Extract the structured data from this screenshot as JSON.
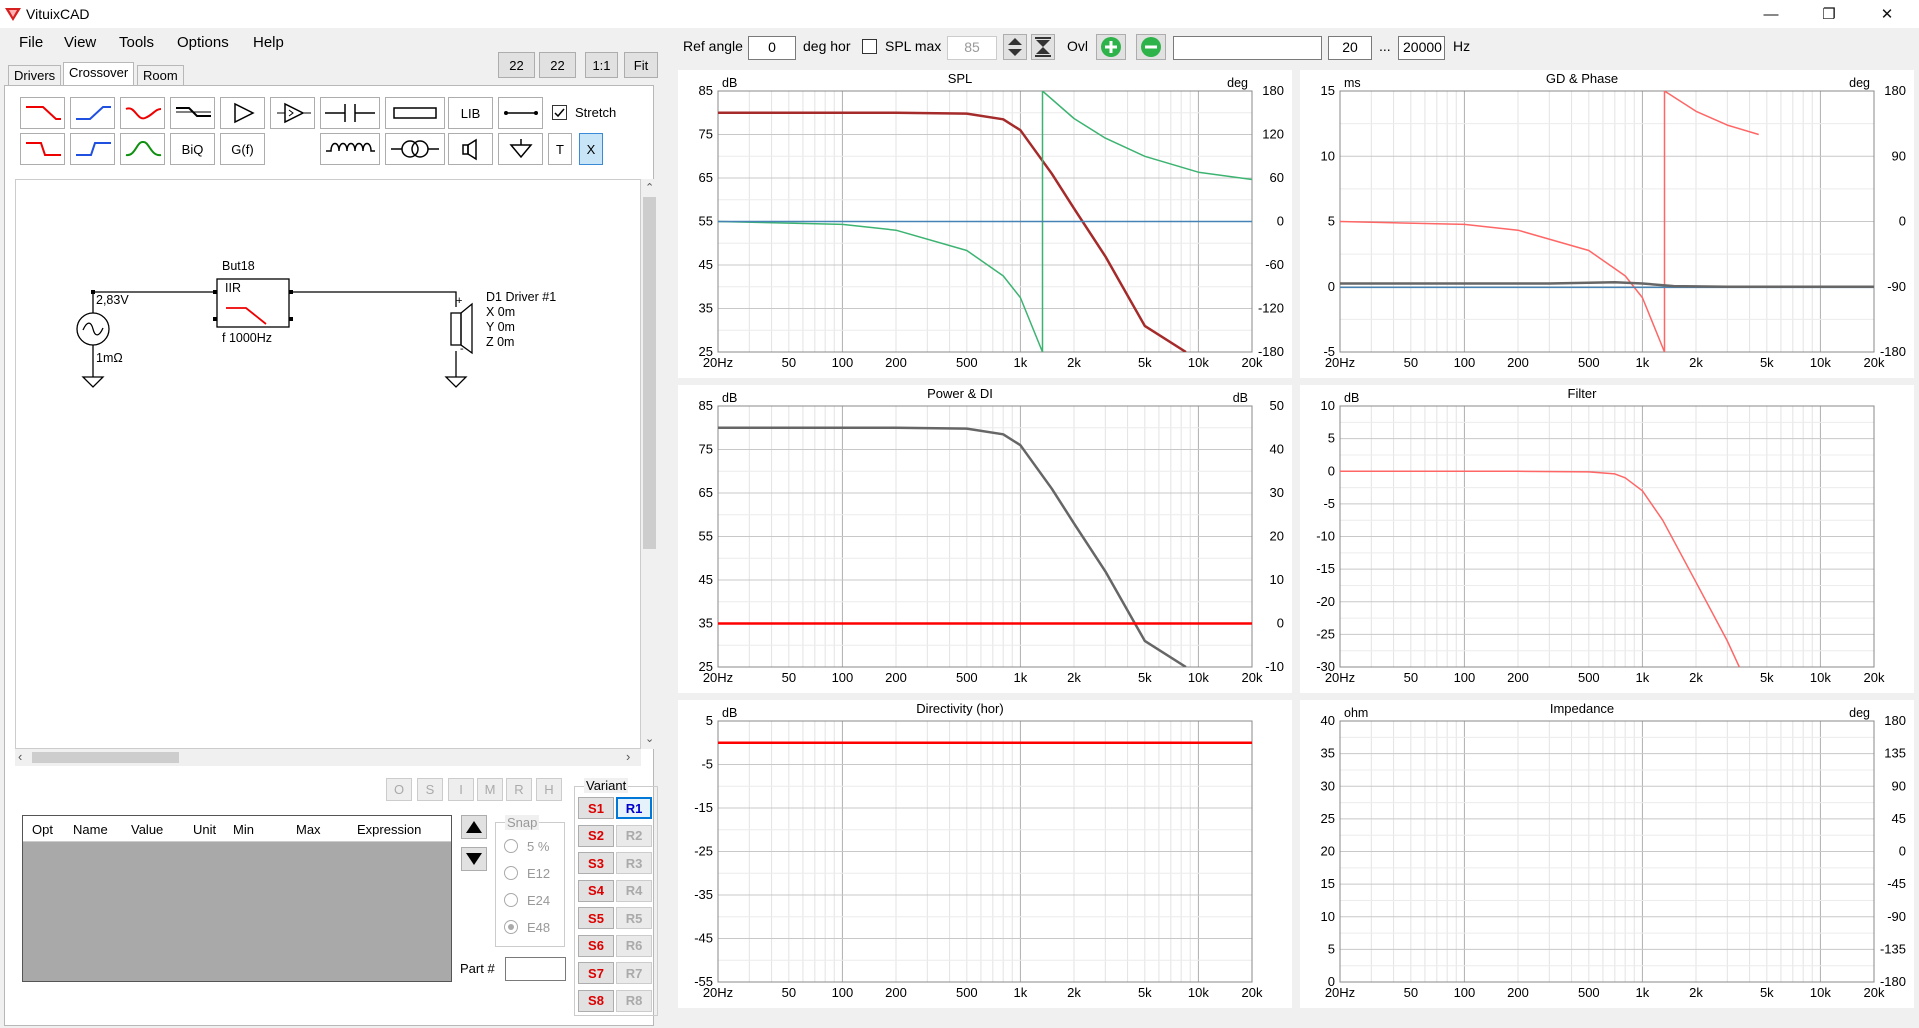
{
  "window": {
    "title": "VituixCAD"
  },
  "menu": [
    "File",
    "View",
    "Tools",
    "Options",
    "Help"
  ],
  "tabs": {
    "drivers": "Drivers",
    "crossover": "Crossover",
    "room": "Room"
  },
  "zoom": {
    "a": "22",
    "b": "22",
    "one": "1:1",
    "fit": "Fit"
  },
  "tools": {
    "lib": "LIB",
    "biq": "BiQ",
    "gf": "G(f)",
    "t": "T",
    "x": "X",
    "stretch": "Stretch"
  },
  "schematic": {
    "voltage": "2,83V",
    "resistance": "1mΩ",
    "block_name": "But18",
    "block_type": "IIR",
    "block_freq": "f   1000Hz",
    "driver_name": "D1 Driver #1",
    "driver_x": "X 0m",
    "driver_y": "Y 0m",
    "driver_z": "Z 0m",
    "plus": "+",
    "minus": "-"
  },
  "part_buttons": [
    "O",
    "S",
    "I",
    "M",
    "R",
    "H"
  ],
  "table": {
    "columns": [
      "Opt",
      "Name",
      "Value",
      "Unit",
      "Min",
      "Max",
      "Expression"
    ]
  },
  "snap": {
    "label": "Snap",
    "options": [
      "5 %",
      "E12",
      "E24",
      "E48"
    ],
    "selected": "E48"
  },
  "part_label": "Part #",
  "variant": {
    "label": "Variant",
    "s": [
      "S1",
      "S2",
      "S3",
      "S4",
      "S5",
      "S6",
      "S7",
      "S8"
    ],
    "r": [
      "R1",
      "R2",
      "R3",
      "R4",
      "R5",
      "R6",
      "R7",
      "R8"
    ],
    "active": "R1"
  },
  "toolbar": {
    "ref_angle_label": "Ref angle",
    "ref_angle_value": "0",
    "deg_hor": "deg hor",
    "spl_max_label": "SPL max",
    "spl_max_value": "85",
    "ovl": "Ovl",
    "freq_min": "20",
    "ellipsis": "...",
    "freq_max": "20000",
    "hz": "Hz"
  },
  "colors": {
    "red": "#ff0000",
    "darkred": "#a52a2a",
    "green": "#3cb371",
    "blue": "#4682b4",
    "gray": "#666666",
    "pink": "#ff6666",
    "accent": "#0078d7"
  },
  "chart_data": [
    {
      "type": "line",
      "title": "SPL",
      "ylabel": "dB",
      "y2label": "deg",
      "xlim": [
        20,
        20000
      ],
      "xscale": "log",
      "x_ticks": [
        "20Hz",
        "50",
        "100",
        "200",
        "500",
        "1k",
        "2k",
        "5k",
        "10k",
        "20k"
      ],
      "ylim": [
        25,
        85
      ],
      "y_ticks": [
        "85",
        "75",
        "65",
        "55",
        "45",
        "35",
        "25"
      ],
      "y2lim": [
        -180,
        180
      ],
      "y2_ticks": [
        "180",
        "120",
        "60",
        "0",
        "-60",
        "-120",
        "-180"
      ],
      "series": [
        {
          "color": "#a52a2a",
          "axis": "y",
          "x": [
            20,
            200,
            500,
            800,
            1000,
            1500,
            2000,
            3000,
            5000,
            8500
          ],
          "y": [
            80,
            80,
            79.8,
            78.5,
            76,
            66,
            58,
            47,
            31,
            25
          ]
        },
        {
          "color": "#3cb371",
          "axis": "y2",
          "x": [
            20,
            100,
            200,
            500,
            800,
            1000,
            1330,
            1331,
            2000,
            3000,
            5000,
            10000,
            20000
          ],
          "y": [
            0,
            -4,
            -12,
            -40,
            -75,
            -105,
            -180,
            180,
            142,
            115,
            90,
            68,
            58
          ]
        },
        {
          "color": "#4682b4",
          "axis": "y2",
          "x": [
            20,
            20000
          ],
          "y": [
            0,
            0
          ]
        }
      ]
    },
    {
      "type": "line",
      "title": "GD & Phase",
      "ylabel": "ms",
      "y2label": "deg",
      "xlim": [
        20,
        20000
      ],
      "xscale": "log",
      "x_ticks": [
        "20Hz",
        "50",
        "100",
        "200",
        "500",
        "1k",
        "2k",
        "5k",
        "10k",
        "20k"
      ],
      "ylim": [
        -5,
        15
      ],
      "y_ticks": [
        "15",
        "10",
        "5",
        "0",
        "-5"
      ],
      "y2lim": [
        -180,
        180
      ],
      "y2_ticks": [
        "180",
        "90",
        "0",
        "-90",
        "-180"
      ],
      "series": [
        {
          "color": "#ff6666",
          "axis": "y2",
          "x": [
            20,
            100,
            200,
            500,
            800,
            1000,
            1330,
            1331,
            2000,
            3000,
            4500
          ],
          "y": [
            0,
            -4,
            -12,
            -40,
            -75,
            -105,
            -180,
            180,
            152,
            133,
            120
          ]
        },
        {
          "color": "#4682b4",
          "axis": "y",
          "x": [
            20,
            20000
          ],
          "y": [
            -0.05,
            -0.05
          ]
        },
        {
          "color": "#666666",
          "axis": "y",
          "x": [
            20,
            300,
            700,
            1000,
            1500,
            3000,
            20000
          ],
          "y": [
            0.25,
            0.25,
            0.35,
            0.25,
            0.05,
            0,
            0
          ]
        }
      ]
    },
    {
      "type": "line",
      "title": "Power & DI",
      "ylabel": "dB",
      "y2label": "dB",
      "xlim": [
        20,
        20000
      ],
      "xscale": "log",
      "x_ticks": [
        "20Hz",
        "50",
        "100",
        "200",
        "500",
        "1k",
        "2k",
        "5k",
        "10k",
        "20k"
      ],
      "ylim": [
        25,
        85
      ],
      "y_ticks": [
        "85",
        "75",
        "65",
        "55",
        "45",
        "35",
        "25"
      ],
      "y2lim": [
        -10,
        50
      ],
      "y2_ticks": [
        "50",
        "40",
        "30",
        "20",
        "10",
        "0",
        "-10"
      ],
      "series": [
        {
          "color": "#666666",
          "axis": "y",
          "x": [
            20,
            200,
            500,
            800,
            1000,
            1500,
            2000,
            3000,
            5000,
            8500
          ],
          "y": [
            80,
            80,
            79.8,
            78.5,
            76,
            66,
            58,
            47,
            31,
            25
          ]
        },
        {
          "color": "#ff0000",
          "axis": "y2",
          "x": [
            20,
            20000
          ],
          "y": [
            0,
            0
          ]
        }
      ]
    },
    {
      "type": "line",
      "title": "Filter",
      "ylabel": "dB",
      "xlim": [
        20,
        20000
      ],
      "xscale": "log",
      "x_ticks": [
        "20Hz",
        "50",
        "100",
        "200",
        "500",
        "1k",
        "2k",
        "5k",
        "10k",
        "20k"
      ],
      "ylim": [
        -30,
        10
      ],
      "y_ticks": [
        "10",
        "5",
        "0",
        "-5",
        "-10",
        "-15",
        "-20",
        "-25",
        "-30"
      ],
      "series": [
        {
          "color": "#ff6666",
          "axis": "y",
          "x": [
            20,
            200,
            500,
            700,
            800,
            1000,
            1300,
            2000,
            3000,
            3500
          ],
          "y": [
            0,
            0,
            -0.1,
            -0.4,
            -1,
            -3,
            -7.5,
            -17,
            -26,
            -30
          ]
        }
      ]
    },
    {
      "type": "line",
      "title": "Directivity (hor)",
      "ylabel": "dB",
      "xlim": [
        20,
        20000
      ],
      "xscale": "log",
      "x_ticks": [
        "20Hz",
        "50",
        "100",
        "200",
        "500",
        "1k",
        "2k",
        "5k",
        "10k",
        "20k"
      ],
      "ylim": [
        -55,
        5
      ],
      "y_ticks": [
        "5",
        "-5",
        "-15",
        "-25",
        "-35",
        "-45",
        "-55"
      ],
      "series": [
        {
          "color": "#ff0000",
          "axis": "y",
          "x": [
            20,
            20000
          ],
          "y": [
            0,
            0
          ]
        }
      ]
    },
    {
      "type": "line",
      "title": "Impedance",
      "ylabel": "ohm",
      "y2label": "deg",
      "xlim": [
        20,
        20000
      ],
      "xscale": "log",
      "x_ticks": [
        "20Hz",
        "50",
        "100",
        "200",
        "500",
        "1k",
        "2k",
        "5k",
        "10k",
        "20k"
      ],
      "ylim": [
        0,
        40
      ],
      "y_ticks": [
        "40",
        "35",
        "30",
        "25",
        "20",
        "15",
        "10",
        "5",
        "0"
      ],
      "y2lim": [
        -180,
        180
      ],
      "y2_ticks": [
        "180",
        "135",
        "90",
        "45",
        "0",
        "-45",
        "-90",
        "-135",
        "-180"
      ],
      "series": []
    }
  ]
}
